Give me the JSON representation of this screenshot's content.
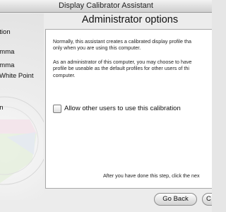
{
  "window": {
    "title": "Display Calibrator Assistant"
  },
  "sidebar": {
    "items": [
      {
        "label": "ation"
      },
      {
        "label": "amma"
      },
      {
        "label": "amma"
      },
      {
        "label": "White Point"
      },
      {
        "label": "on"
      }
    ]
  },
  "page": {
    "title": "Administrator options",
    "paragraph1": [
      "Normally, this assistant creates a calibrated display profile tha",
      "only when you are using this computer."
    ],
    "paragraph2": [
      "As an administrator of this computer, you may choose to have",
      "profile be useable as the default profiles for other users of thi",
      "computer."
    ],
    "checkbox": {
      "label": "Allow other users to use this calibration",
      "checked": false
    },
    "footer_note": "After you have done this step, click the nex"
  },
  "buttons": {
    "back": "Go Back",
    "continue": "C"
  }
}
